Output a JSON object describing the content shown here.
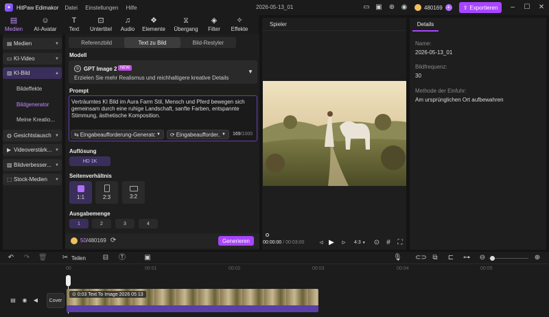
{
  "app": {
    "name": "HitPaw Edimakor",
    "menu": [
      "Datei",
      "Einstellungen",
      "Hilfe"
    ],
    "project_title": "2026-05-13_01",
    "credits": "480169",
    "export_label": "Exportieren"
  },
  "toolbar": [
    {
      "label": "Medien",
      "icon": "media-icon",
      "active": true
    },
    {
      "label": "AI-Avatar",
      "icon": "avatar-icon"
    },
    {
      "label": "Text",
      "icon": "text-icon"
    },
    {
      "label": "Untertitel",
      "icon": "subtitle-icon"
    },
    {
      "label": "Audio",
      "icon": "audio-icon"
    },
    {
      "label": "Elemente",
      "icon": "elements-icon"
    },
    {
      "label": "Übergang",
      "icon": "transition-icon"
    },
    {
      "label": "Filter",
      "icon": "filter-icon"
    },
    {
      "label": "Effekte",
      "icon": "effects-icon"
    }
  ],
  "leftnav": {
    "sections": [
      "Medien",
      "KI-Video",
      "KI-Bild",
      "Gesichtstausch",
      "Videoverstärk...",
      "Bildverbesser...",
      "Stock-Medien"
    ],
    "sub": [
      "Bildeffekte",
      "Bildgenerator",
      "Meine Kreatio..."
    ]
  },
  "panel": {
    "tabs": [
      "Referenzbild",
      "Text zu Bild",
      "Bild-Restyler"
    ],
    "model_heading": "Modell",
    "model_name": "GPT Image 2",
    "model_badge": "NEW",
    "model_desc": "Erzielen Sie mehr Realismus und reichhaltigere kreative Details",
    "prompt_heading": "Prompt",
    "prompt_text": "Verträumtes KI Bild im Aura Farm Stil, Mensch und Pferd bewegen sich gemeinsam durch eine ruhige Landschaft, sanfte Farben, entspannte Stimmung, ästhetische Komposition.",
    "prompt_gen": "Eingabeaufforderung-Generator",
    "prompt_gen2": "Eingabeaufforder...",
    "char_count": "169",
    "char_max": "/1000",
    "res_heading": "Auflösung",
    "res_value": "HD 1K",
    "ratio_heading": "Seitenverhältnis",
    "ratios": [
      "1:1",
      "2:3",
      "3:2"
    ],
    "qty_heading": "Ausgabemenge",
    "qtys": [
      "1",
      "2",
      "3",
      "4"
    ],
    "credits_used": "50",
    "credits_total": "/480169",
    "generate_label": "Generieren"
  },
  "player": {
    "title": "Spieler",
    "time_current": "00:00:00",
    "time_total": "/ 00:03:00",
    "aspect": "4:3"
  },
  "details": {
    "tab": "Details",
    "name_label": "Name:",
    "name_value": "2026-05-13_01",
    "fps_label": "Bildfrequenz:",
    "fps_value": "30",
    "import_label": "Methode der Einfuhr:",
    "import_value": "Am ursprünglichen Ort aufbewahren"
  },
  "timeline": {
    "split_label": "Teilen",
    "cover_label": "Cover",
    "ruler": [
      "00",
      "00:01",
      "00:02",
      "00:03",
      "00:04",
      "00:05"
    ],
    "clip_label": "0:03 Text To Image 2026 05 13"
  },
  "colors": {
    "accent": "#a845ff"
  }
}
